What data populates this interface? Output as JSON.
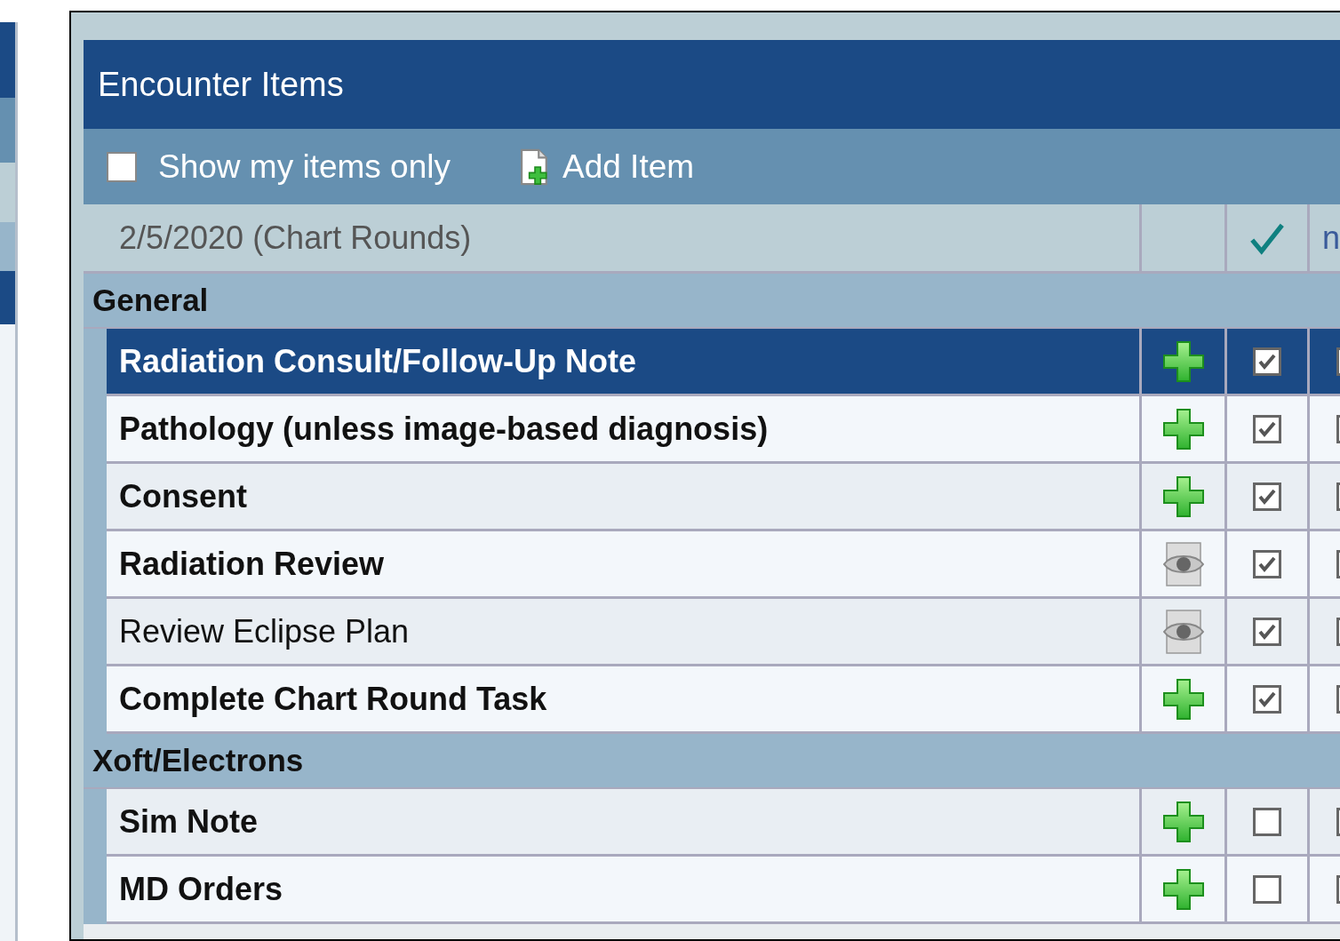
{
  "window": {
    "title": "Encounter Items"
  },
  "toolbar": {
    "show_mine_only": {
      "label": "Show my items only",
      "checked": false
    },
    "add_button": {
      "label": "Add Item"
    }
  },
  "header": {
    "date": "2/5/2020 (Chart Rounds)",
    "column_4": "n"
  },
  "groups": [
    {
      "name": "General",
      "items": [
        {
          "name": "Radiation Consult/Follow-Up Note",
          "bold": true,
          "selected": true,
          "kind": "add",
          "checked": true
        },
        {
          "name": "Pathology (unless image-based diagnosis)",
          "bold": true,
          "selected": false,
          "kind": "add",
          "checked": true
        },
        {
          "name": "Consent",
          "bold": true,
          "selected": false,
          "kind": "add",
          "checked": true
        },
        {
          "name": "Radiation Review",
          "bold": true,
          "selected": false,
          "kind": "view",
          "checked": true
        },
        {
          "name": "Review Eclipse Plan",
          "bold": false,
          "selected": false,
          "kind": "view",
          "checked": true
        },
        {
          "name": "Complete Chart Round Task",
          "bold": true,
          "selected": false,
          "kind": "add",
          "checked": true
        }
      ]
    },
    {
      "name": "Xoft/Electrons",
      "items": [
        {
          "name": "Sim Note",
          "bold": true,
          "selected": false,
          "kind": "add",
          "checked": false
        },
        {
          "name": "MD Orders",
          "bold": true,
          "selected": false,
          "kind": "add",
          "checked": false
        }
      ]
    }
  ]
}
